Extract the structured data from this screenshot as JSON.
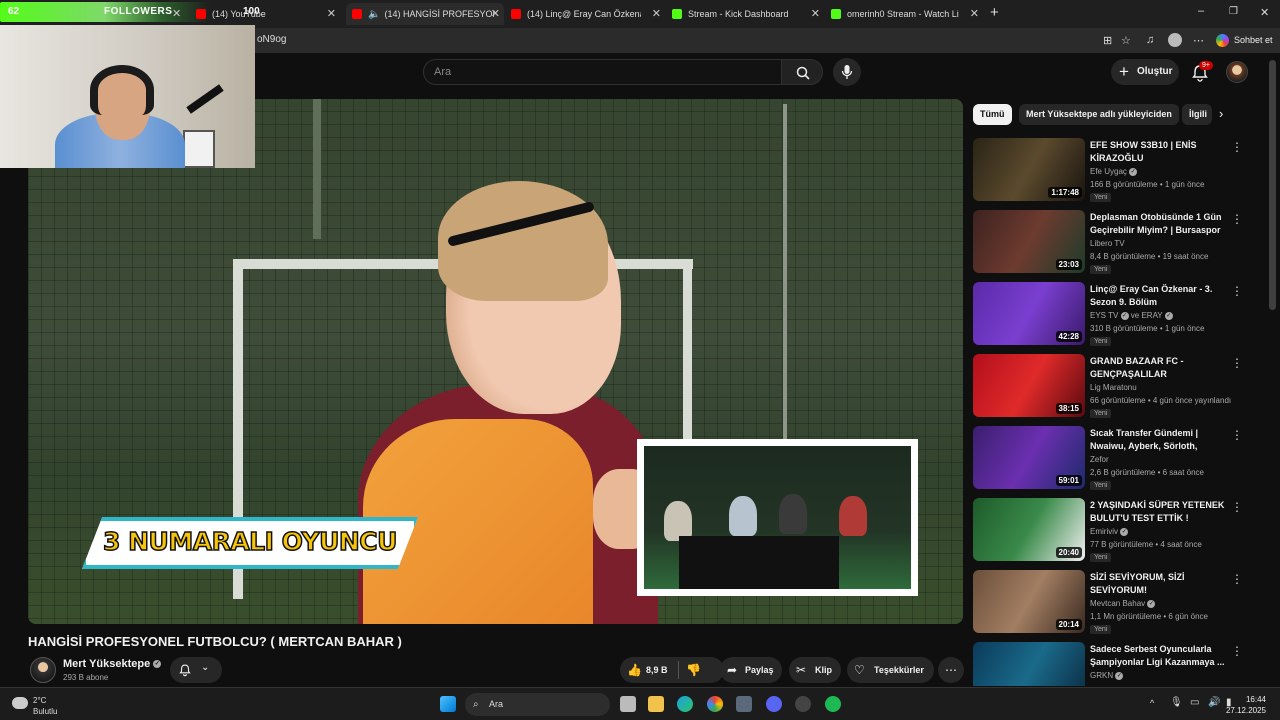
{
  "browser": {
    "followers": {
      "count_left": "62",
      "label": "FOLLOWERS",
      "count_right": "100"
    },
    "tabs": [
      {
        "label": "(14) YouTube"
      },
      {
        "label": "(14) HANGİSİ PROFESYONEL F"
      },
      {
        "label": "(14) Linç@ Eray Can Özkenar - 3. S"
      },
      {
        "label": "Stream - Kick Dashboard"
      },
      {
        "label": "omerinh0 Stream - Watch Live on"
      }
    ],
    "url_fragment": "oN9og",
    "chat_button": "Sohbet et"
  },
  "youtube": {
    "search_placeholder": "Ara",
    "create_label": "Oluştur",
    "notif_badge": "9+"
  },
  "video": {
    "overlay_text": "3 NUMARALI OYUNCU",
    "title": "HANGİSİ PROFESYONEL FUTBOLCU? ( MERTCAN BAHAR )",
    "channel": "Mert Yüksektepe",
    "subscribers": "293 B abone",
    "likes": "8,9 B",
    "share_label": "Paylaş",
    "clip_label": "Klip",
    "thanks_label": "Teşekkürler"
  },
  "chips": [
    "Tümü",
    "Mert Yüksektepe adlı yükleyiciden",
    "İlgili"
  ],
  "recommendations": [
    {
      "title": "EFE SHOW S3B10 | ENİS KİRAZOĞLU",
      "channel": "Efe Uygaç",
      "views": "166 B görüntüleme",
      "age": "1 gün önce",
      "duration": "1:17:48",
      "badge": "Yeni",
      "verified": true
    },
    {
      "title": "Deplasman Otobüsünde 1 Gün Geçirebilir Miyim? | Bursaspor ...",
      "channel": "Libero TV",
      "views": "8,4 B görüntüleme",
      "age": "19 saat önce",
      "duration": "23:03",
      "badge": "Yeni",
      "verified": false
    },
    {
      "title": "Linç@ Eray Can Özkenar - 3. Sezon 9. Bölüm",
      "channel": "EYS TV",
      "channel2": "ve ERAY",
      "views": "310 B görüntüleme",
      "age": "1 gün önce",
      "duration": "42:28",
      "badge": "Yeni",
      "verified": true
    },
    {
      "title": "GRAND BAZAAR FC - GENÇPAŞALILAR",
      "channel": "Lig Maratonu",
      "views": "66 görüntüleme",
      "age": "4 gün önce yayınlandı",
      "duration": "38:15",
      "badge": "Yeni",
      "verified": false
    },
    {
      "title": "Sıcak Transfer Gündemi | Nwaiwu, Ayberk, Sörloth, Rube...",
      "channel": "Zefor",
      "views": "2,6 B görüntüleme",
      "age": "6 saat önce",
      "duration": "59:01",
      "badge": "Yeni",
      "verified": false
    },
    {
      "title": "2 YAŞINDAKİ SÜPER YETENEK BULUT'U TEST ETTİK !",
      "channel": "Emiriviv",
      "views": "77 B görüntüleme",
      "age": "4 saat önce",
      "duration": "20:40",
      "badge": "Yeni",
      "verified": true
    },
    {
      "title": "SİZİ SEVİYORUM, SİZİ SEVİYORUM!",
      "channel": "Mevtcan Bahav",
      "views": "1,1 Mn görüntüleme",
      "age": "6 gün önce",
      "duration": "20:14",
      "badge": "Yeni",
      "verified": true
    },
    {
      "title": "Sadece Serbest Oyuncularla Şampiyonlar Ligi Kazanmaya ...",
      "channel": "GRKN",
      "views": "",
      "age": "",
      "duration": "",
      "badge": "",
      "verified": true
    }
  ],
  "taskbar": {
    "weather_temp": "2°C",
    "weather_desc": "Bulutlu",
    "search_label": "Ara",
    "time": "16:44",
    "date": "27.12.2025"
  }
}
